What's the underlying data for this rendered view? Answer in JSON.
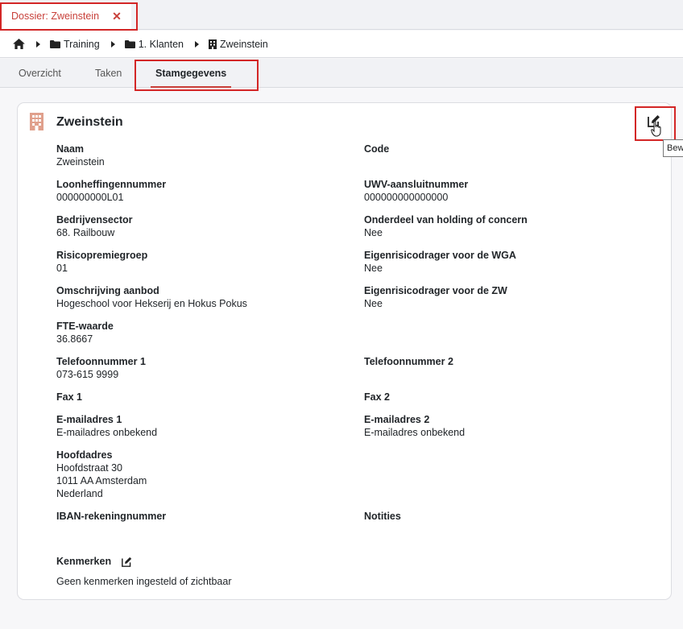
{
  "doc_tab": {
    "label": "Dossier: Zweinstein",
    "close_symbol": "✕"
  },
  "breadcrumb": [
    {
      "icon": "home-icon",
      "label": ""
    },
    {
      "icon": "folder-icon",
      "label": "Training"
    },
    {
      "icon": "folder-icon",
      "label": "1. Klanten"
    },
    {
      "icon": "building-icon",
      "label": "Zweinstein"
    }
  ],
  "tabs": [
    {
      "label": "Overzicht",
      "active": false
    },
    {
      "label": "Taken",
      "active": false
    },
    {
      "label": "Stamgegevens",
      "active": true
    }
  ],
  "card": {
    "title": "Zweinstein",
    "tooltip": "Bew",
    "fields": {
      "naam": {
        "label": "Naam",
        "value": "Zweinstein"
      },
      "code": {
        "label": "Code",
        "value": ""
      },
      "loonheffing": {
        "label": "Loonheffingennummer",
        "value": "000000000L01"
      },
      "uwv": {
        "label": "UWV-aansluitnummer",
        "value": "000000000000000"
      },
      "sector": {
        "label": "Bedrijvensector",
        "value": "68. Railbouw"
      },
      "holding": {
        "label": "Onderdeel van holding of concern",
        "value": "Nee"
      },
      "risico": {
        "label": "Risicopremiegroep",
        "value": "01"
      },
      "wga": {
        "label": "Eigenrisicodrager voor de WGA",
        "value": "Nee"
      },
      "aanbod": {
        "label": "Omschrijving aanbod",
        "value": "Hogeschool voor Hekserij en Hokus Pokus"
      },
      "zw": {
        "label": "Eigenrisicodrager voor de ZW",
        "value": "Nee"
      },
      "fte": {
        "label": "FTE-waarde",
        "value": "36.8667"
      },
      "tel1": {
        "label": "Telefoonnummer 1",
        "value": "073-615 9999"
      },
      "tel2": {
        "label": "Telefoonnummer 2",
        "value": ""
      },
      "fax1": {
        "label": "Fax 1",
        "value": ""
      },
      "fax2": {
        "label": "Fax 2",
        "value": ""
      },
      "email1": {
        "label": "E-mailadres 1",
        "value": "E-mailadres onbekend"
      },
      "email2": {
        "label": "E-mailadres 2",
        "value": "E-mailadres onbekend"
      },
      "adres": {
        "label": "Hoofdadres",
        "line1": "Hoofdstraat 30",
        "line2": "1011 AA Amsterdam",
        "line3": "Nederland"
      },
      "iban": {
        "label": "IBAN-rekeningnummer",
        "value": ""
      },
      "notities": {
        "label": "Notities",
        "value": ""
      }
    },
    "kenmerken": {
      "label": "Kenmerken",
      "text": "Geen kenmerken ingesteld of zichtbaar"
    }
  },
  "colors": {
    "accent": "#c8403a",
    "highlight": "#d32626",
    "building_icon": "#e0a08c"
  }
}
